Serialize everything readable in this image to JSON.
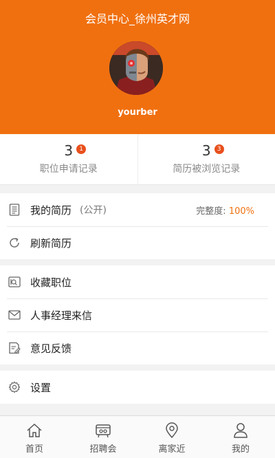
{
  "header": {
    "title": "会员中心_徐州英才网",
    "username": "yourber"
  },
  "stats": [
    {
      "count": "3",
      "badge": "1",
      "label": "职位申请记录"
    },
    {
      "count": "3",
      "badge": "3",
      "label": "简历被浏览记录"
    }
  ],
  "resume": {
    "label": "我的简历",
    "visibility": "(公开)",
    "completeness_label": "完整度:",
    "completeness_value": "100%"
  },
  "refresh": {
    "label": "刷新简历"
  },
  "menu": {
    "favorites": "收藏职位",
    "hr_letters": "人事经理来信",
    "feedback": "意见反馈",
    "settings": "设置"
  },
  "tabs": [
    {
      "label": "首页",
      "icon": "home-icon"
    },
    {
      "label": "招聘会",
      "icon": "job-fair-icon"
    },
    {
      "label": "离家近",
      "icon": "location-pin-icon"
    },
    {
      "label": "我的",
      "icon": "user-icon"
    }
  ],
  "colors": {
    "accent": "#f07010",
    "badge": "#e8501d"
  }
}
